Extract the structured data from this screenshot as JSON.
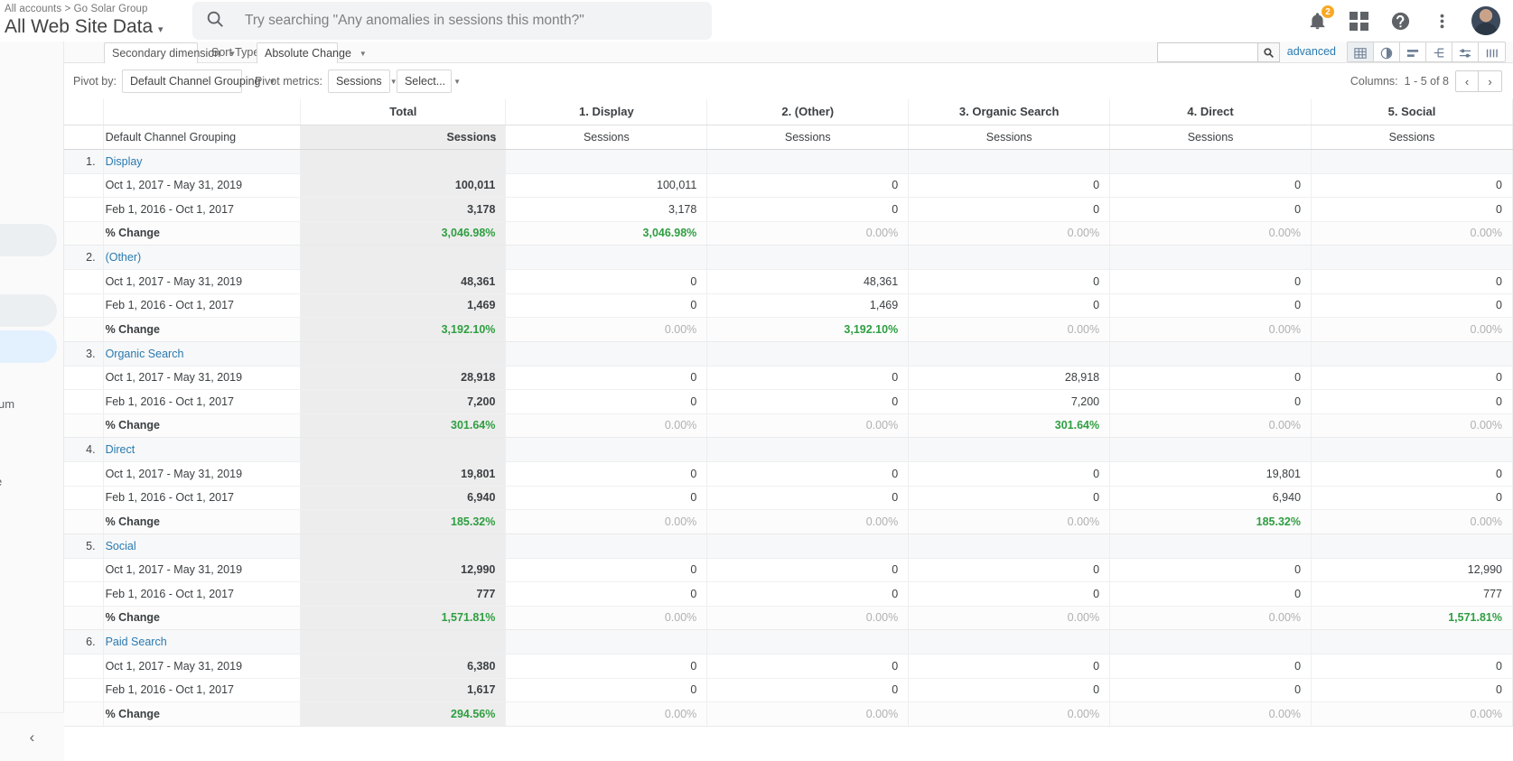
{
  "topbar": {
    "breadcrumb": "All accounts  >  Go Solar Group",
    "property_title": "All Web Site Data",
    "caret": "▾",
    "search_placeholder": "Try searching \"Any anomalies in sessions this month?\"",
    "notification_count": "2",
    "icons": {
      "search": "search-icon",
      "bell": "notifications-icon",
      "apps": "apps-grid-icon",
      "help": "help-icon",
      "more": "more-vertical-icon",
      "avatar": "user-avatar"
    }
  },
  "leftnav": {
    "fragment_1": "um",
    "fragment_2": "e",
    "collapse": "‹"
  },
  "toolbar": {
    "secondary_dimension": "Secondary dimension",
    "sort_type_label": "Sort Type:",
    "sort_type_value": "Absolute Change",
    "search_value": "",
    "advanced": "advanced",
    "view_icons": [
      {
        "name": "table-view-icon",
        "active": true
      },
      {
        "name": "percentage-pie-view-icon",
        "active": false
      },
      {
        "name": "performance-bar-view-icon",
        "active": false
      },
      {
        "name": "comparison-view-icon",
        "active": false
      },
      {
        "name": "pivot-view-icon",
        "active": false
      },
      {
        "name": "term-cloud-view-icon",
        "active": false
      }
    ]
  },
  "pivot": {
    "pivot_by_label": "Pivot by:",
    "pivot_by_value": "Default Channel Grouping",
    "pivot_metrics_label": "Pivot metrics:",
    "metric_1": "Sessions",
    "metric_2": "Select...",
    "columns_label": "Columns:",
    "columns_range": "1 - 5 of 8",
    "prev": "‹",
    "next": "›"
  },
  "table": {
    "dimension_header": "Default Channel Grouping",
    "total_label": "Total",
    "total_metric": "Sessions",
    "sort_arrow": "↓",
    "pivot_columns": [
      {
        "title": "1. Display",
        "metric": "Sessions"
      },
      {
        "title": "2. (Other)",
        "metric": "Sessions"
      },
      {
        "title": "3. Organic Search",
        "metric": "Sessions"
      },
      {
        "title": "4. Direct",
        "metric": "Sessions"
      },
      {
        "title": "5. Social",
        "metric": "Sessions"
      }
    ],
    "row_labels": {
      "period_current": "Oct 1, 2017 - May 31, 2019",
      "period_previous": "Feb 1, 2016 - Oct 1, 2017",
      "change": "% Change"
    },
    "rows": [
      {
        "index": "1.",
        "name": "Display",
        "current": {
          "total": "100,011",
          "pivots": [
            "100,011",
            "0",
            "0",
            "0",
            "0"
          ]
        },
        "previous": {
          "total": "3,178",
          "pivots": [
            "3,178",
            "0",
            "0",
            "0",
            "0"
          ]
        },
        "change": {
          "total": "3,046.98%",
          "pivots": [
            "3,046.98%",
            "0.00%",
            "0.00%",
            "0.00%",
            "0.00%"
          ]
        }
      },
      {
        "index": "2.",
        "name": "(Other)",
        "current": {
          "total": "48,361",
          "pivots": [
            "0",
            "48,361",
            "0",
            "0",
            "0"
          ]
        },
        "previous": {
          "total": "1,469",
          "pivots": [
            "0",
            "1,469",
            "0",
            "0",
            "0"
          ]
        },
        "change": {
          "total": "3,192.10%",
          "pivots": [
            "0.00%",
            "3,192.10%",
            "0.00%",
            "0.00%",
            "0.00%"
          ]
        }
      },
      {
        "index": "3.",
        "name": "Organic Search",
        "current": {
          "total": "28,918",
          "pivots": [
            "0",
            "0",
            "28,918",
            "0",
            "0"
          ]
        },
        "previous": {
          "total": "7,200",
          "pivots": [
            "0",
            "0",
            "7,200",
            "0",
            "0"
          ]
        },
        "change": {
          "total": "301.64%",
          "pivots": [
            "0.00%",
            "0.00%",
            "301.64%",
            "0.00%",
            "0.00%"
          ]
        }
      },
      {
        "index": "4.",
        "name": "Direct",
        "current": {
          "total": "19,801",
          "pivots": [
            "0",
            "0",
            "0",
            "19,801",
            "0"
          ]
        },
        "previous": {
          "total": "6,940",
          "pivots": [
            "0",
            "0",
            "0",
            "6,940",
            "0"
          ]
        },
        "change": {
          "total": "185.32%",
          "pivots": [
            "0.00%",
            "0.00%",
            "0.00%",
            "185.32%",
            "0.00%"
          ]
        }
      },
      {
        "index": "5.",
        "name": "Social",
        "current": {
          "total": "12,990",
          "pivots": [
            "0",
            "0",
            "0",
            "0",
            "12,990"
          ]
        },
        "previous": {
          "total": "777",
          "pivots": [
            "0",
            "0",
            "0",
            "0",
            "777"
          ]
        },
        "change": {
          "total": "1,571.81%",
          "pivots": [
            "0.00%",
            "0.00%",
            "0.00%",
            "0.00%",
            "1,571.81%"
          ]
        }
      },
      {
        "index": "6.",
        "name": "Paid Search",
        "current": {
          "total": "6,380",
          "pivots": [
            "0",
            "0",
            "0",
            "0",
            "0"
          ]
        },
        "previous": {
          "total": "1,617",
          "pivots": [
            "0",
            "0",
            "0",
            "0",
            "0"
          ]
        },
        "change": {
          "total": "294.56%",
          "pivots": [
            "0.00%",
            "0.00%",
            "0.00%",
            "0.00%",
            "0.00%"
          ]
        }
      }
    ]
  },
  "colors": {
    "link": "#2a7ab0",
    "positive": "#2f9e41",
    "muted": "#b0b0b0",
    "badge": "#f9a825",
    "total_bg": "#ededed"
  }
}
